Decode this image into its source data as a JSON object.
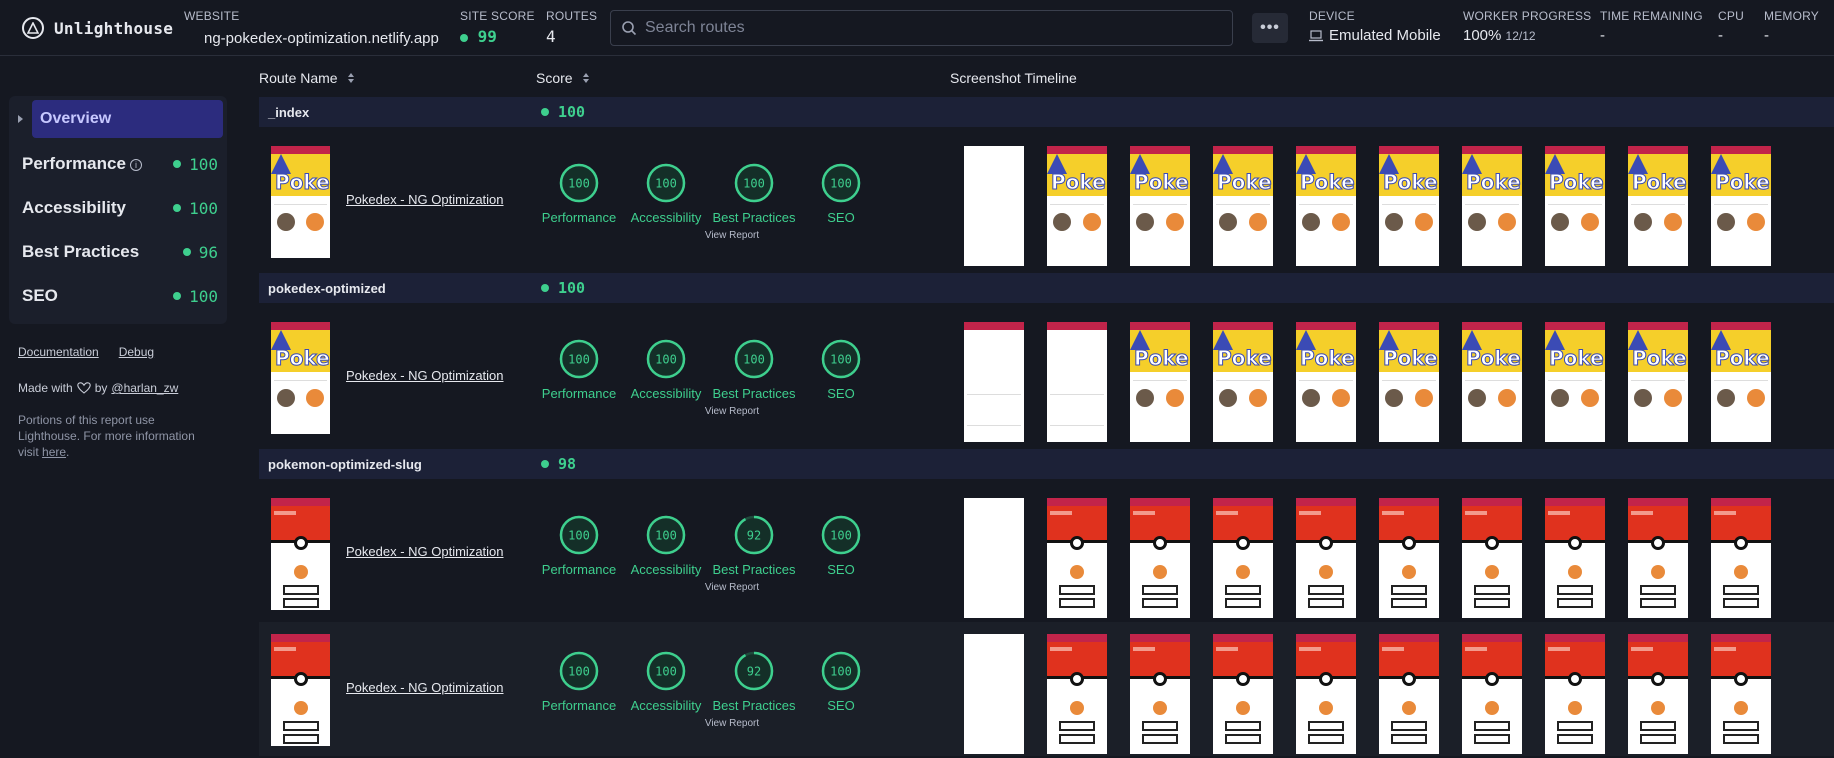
{
  "header": {
    "brand": "Unlighthouse",
    "website_label": "WEBSITE",
    "website": "ng-pokedex-optimization.netlify.app",
    "site_score_label": "SITE SCORE",
    "site_score": "99",
    "routes_label": "ROUTES",
    "routes": "4",
    "search_placeholder": "Search routes",
    "more_label": "•••",
    "device_label": "DEVICE",
    "device": "Emulated Mobile",
    "worker_label": "WORKER PROGRESS",
    "worker_percent": "100%",
    "worker_count": "12/12",
    "time_label": "TIME REMAINING",
    "time": "-",
    "cpu_label": "CPU",
    "cpu": "-",
    "memory_label": "MEMORY",
    "memory": "-"
  },
  "sidebar": {
    "overview": "Overview",
    "items": [
      {
        "label": "Performance",
        "score": "100"
      },
      {
        "label": "Accessibility",
        "score": "100"
      },
      {
        "label": "Best Practices",
        "score": "96"
      },
      {
        "label": "SEO",
        "score": "100"
      }
    ],
    "documentation": "Documentation",
    "debug": "Debug",
    "made_with": "Made with",
    "by": "by",
    "author": "@harlan_zw",
    "portions": "Portions of this report use Lighthouse. For more information visit",
    "here": "here",
    "period": "."
  },
  "table": {
    "col_route": "Route Name",
    "col_score": "Score",
    "col_timeline": "Screenshot Timeline",
    "view_report": "View Report",
    "groups": [
      {
        "name": "_index",
        "score": "100"
      },
      {
        "name": "pokedex-optimized",
        "score": "100"
      },
      {
        "name": "pokemon-optimized-slug",
        "score": "98"
      }
    ],
    "rows": [
      {
        "title": "Pokedex - NG Optimization",
        "scores": [
          "100",
          "100",
          "100",
          "100"
        ]
      },
      {
        "title": "Pokedex - NG Optimization",
        "scores": [
          "100",
          "100",
          "100",
          "100"
        ]
      },
      {
        "title": "Pokedex - NG Optimization",
        "scores": [
          "100",
          "100",
          "92",
          "100"
        ]
      },
      {
        "title": "Pokedex - NG Optimization",
        "scores": [
          "100",
          "100",
          "92",
          "100"
        ]
      }
    ],
    "categories": [
      "Performance",
      "Accessibility",
      "Best Practices",
      "SEO"
    ]
  },
  "colors": {
    "accent_green": "#3ecf8e",
    "overview_bg": "#2c2c7e",
    "pokedex_red": "#c2244a",
    "pokeball_red": "#e0321e"
  }
}
